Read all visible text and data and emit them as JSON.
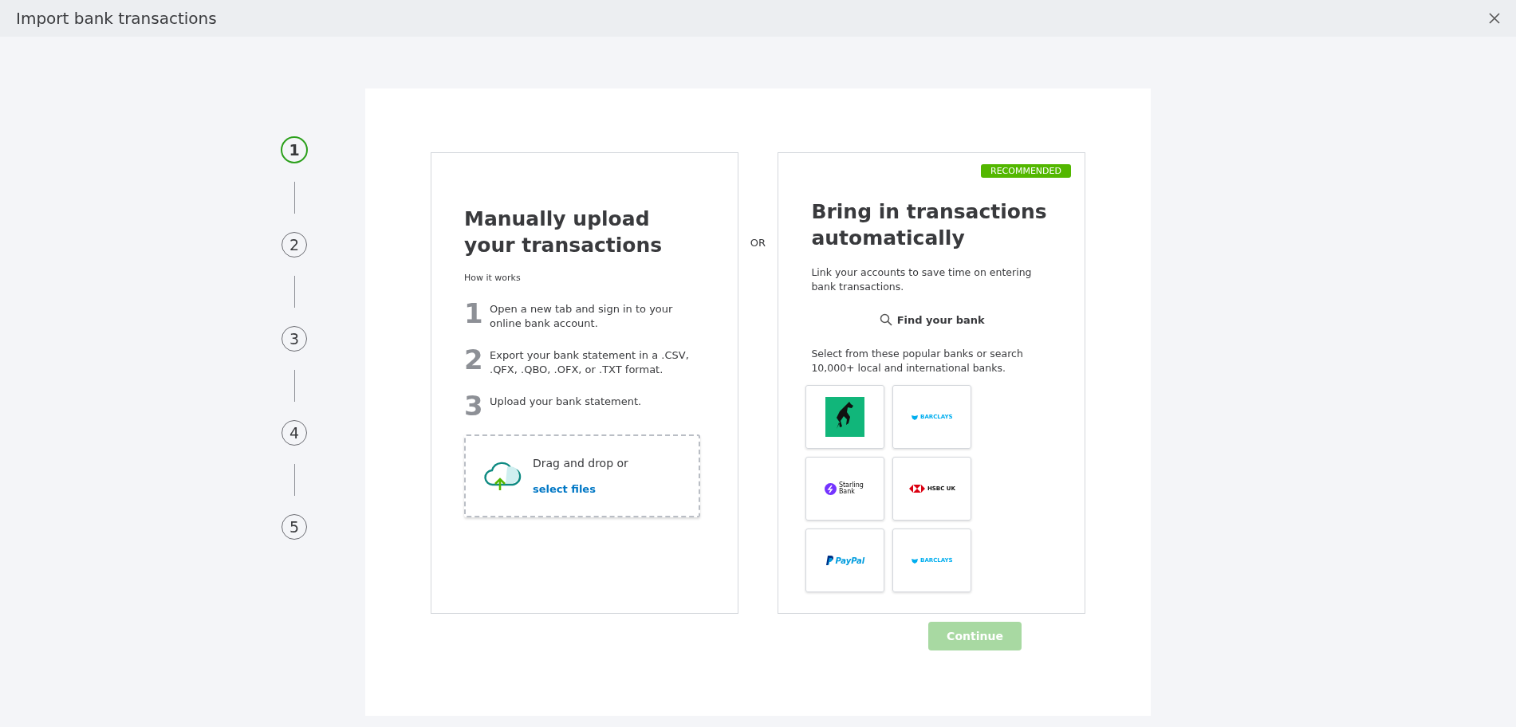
{
  "window": {
    "title": "Import bank transactions"
  },
  "stepper": [
    {
      "label": "1",
      "selected": true
    },
    {
      "label": "2",
      "selected": false
    },
    {
      "label": "3",
      "selected": false
    },
    {
      "label": "4",
      "selected": false
    },
    {
      "label": "5",
      "selected": false
    }
  ],
  "manual": {
    "title": "Manually upload your transactions",
    "subtitle": "How it works",
    "steps": [
      {
        "number": "1",
        "text": "Open a new tab and sign in to your online bank account."
      },
      {
        "number": "2",
        "text": "Export your bank statement in a .CSV, .QFX, .QBO, .OFX, or .TXT format."
      },
      {
        "number": "3",
        "text": "Upload your bank statement."
      }
    ],
    "dropzone": {
      "text": "Drag and drop or ",
      "link": "select files"
    }
  },
  "separator": "OR",
  "automatic": {
    "badge": "RECOMMENDED",
    "title": "Bring in transactions automatically",
    "description": "Link your accounts to save time on entering bank transactions.",
    "find_button": "Find your bank",
    "hint": "Select from these popular banks or search 10,000+ local and international banks.",
    "banks": [
      {
        "kind": "horse"
      },
      {
        "kind": "barclays",
        "label": "BARCLAYS"
      },
      {
        "kind": "starling",
        "label": "Starling Bank"
      },
      {
        "kind": "hsbc",
        "label": "HSBC UK"
      },
      {
        "kind": "paypal",
        "label": "PayPal"
      },
      {
        "kind": "barclays",
        "label": "BARCLAYS"
      }
    ]
  },
  "continue_button": {
    "label": "Continue",
    "disabled": true
  }
}
